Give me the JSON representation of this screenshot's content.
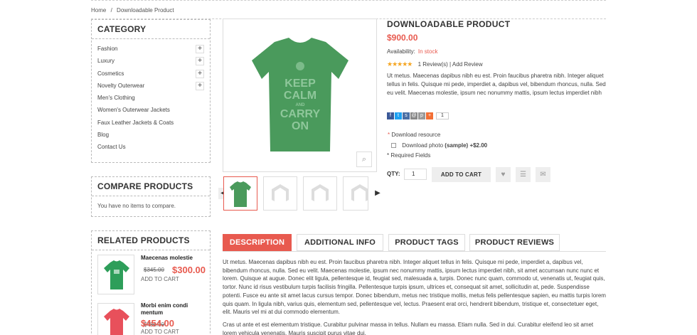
{
  "breadcrumb": {
    "home": "Home",
    "separator": "/",
    "current": "Downloadable Product"
  },
  "category": {
    "title": "CATEGORY",
    "items": [
      {
        "label": "Fashion",
        "expandable": true
      },
      {
        "label": "Luxury",
        "expandable": true
      },
      {
        "label": "Cosmetics",
        "expandable": true
      },
      {
        "label": "Novelty Outerwear",
        "expandable": true
      },
      {
        "label": "Men's Clothing",
        "expandable": false
      },
      {
        "label": "Women's Outerwear Jackets",
        "expandable": false
      },
      {
        "label": "Faux Leather Jackets & Coats",
        "expandable": false
      },
      {
        "label": "Blog",
        "expandable": false
      },
      {
        "label": "Contact Us",
        "expandable": false
      }
    ],
    "expand_symbol": "+"
  },
  "compare": {
    "title": "COMPARE PRODUCTS",
    "empty_text": "You have no items to compare."
  },
  "related": {
    "title": "RELATED PRODUCTS",
    "items": [
      {
        "name": "Maecenas molestie",
        "old_price": "$345.00",
        "price": "$300.00",
        "add": "ADD TO CART",
        "color": "#2e9e5a"
      },
      {
        "name": "Morbi enim condi mentum",
        "old_price": "$480.00",
        "price": "$454.00",
        "add": "ADD TO CART",
        "color": "#e8505b"
      }
    ]
  },
  "product": {
    "title": "DOWNLOADABLE PRODUCT",
    "price": "$900.00",
    "availability_label": "Availability:",
    "availability_value": "In stock",
    "stars": "★★★★★",
    "reviews": "1 Review(s)",
    "review_sep": "|",
    "add_review": "Add Review",
    "short_desc": "Ut metus. Maecenas dapibus nibh eu est. Proin faucibus pharetra nibh. Integer aliquet tellus in felis. Quisque mi pede, imperdiet a, dapibus vel, bibendum rhoncus, nulla. Sed eu velit. Maecenas molestie, ipsum nec nonummy mattis, ipsum lectus imperdiet nibh",
    "share_count": "1",
    "download_required_mark": "*",
    "download_resource": "Download resource",
    "download_photo": "Download photo",
    "download_sample": "(sample)",
    "download_price": "+$2.00",
    "required_fields": "* Required Fields",
    "qty_label": "QTY:",
    "qty_value": "1",
    "add_to_cart": "ADD TO CART",
    "shirt_text": [
      "KEEP",
      "CALM",
      "AND",
      "CARRY",
      "ON"
    ],
    "shirt_color": "#4a9a5c"
  },
  "tabs": [
    "DESCRIPTION",
    "ADDITIONAL INFO",
    "PRODUCT TAGS",
    "PRODUCT REVIEWS"
  ],
  "long_desc": [
    "Ut metus. Maecenas dapibus nibh eu est. Proin faucibus pharetra nibh. Integer aliquet tellus in felis. Quisque mi pede, imperdiet a, dapibus vel, bibendum rhoncus, nulla. Sed eu velit. Maecenas molestie, ipsum nec nonummy mattis, ipsum lectus imperdiet nibh, sit amet accumsan nunc nunc et lorem. Quisque at augue. Donec elit ligula, pellentesque id, feugiat sed, malesuada a, turpis. Donec nunc quam, commodo ut, venenatis ut, feugiat quis, tortor. Nunc id risus vestibulum turpis facilisis fringilla. Pellentesque turpis ipsum, ultrices et, consequat sit amet, sollicitudin at, pede. Suspendisse potenti. Fusce eu ante sit amet lacus cursus tempor. Donec bibendum, metus nec tristique mollis, metus felis pellentesque sapien, eu mattis turpis lorem quis quam. In ligula nibh, varius quis, elementum sed, pellentesque vel, lectus. Praesent erat orci, hendrerit bibendum, tristique et, consectetuer eget, elit. Mauris vel mi at dui commodo elementum.",
    "Cras ut ante et est elementum tristique. Curabitur pulvinar massa in tellus. Nullam eu massa. Etiam nulla. Sed in dui. Curabitur eleifend leo sit amet lorem vehicula venenatis. Mauris suscipit purus vitae dui."
  ],
  "colors": {
    "accent": "#e85a4f"
  }
}
